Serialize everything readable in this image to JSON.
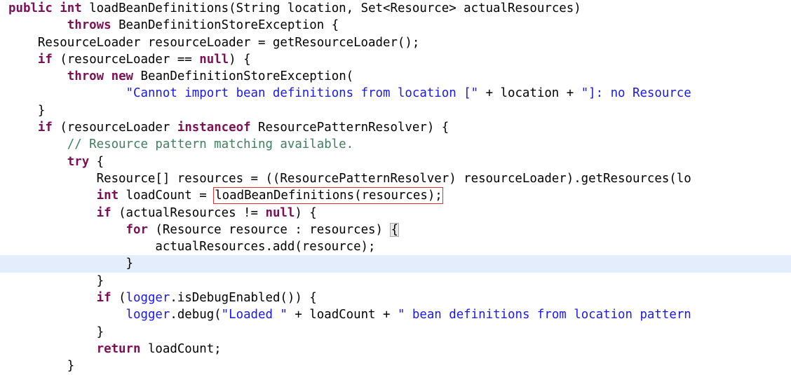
{
  "editor": {
    "language": "java",
    "theme": "eclipse-light",
    "background_color": "#ffffff",
    "highlight_line_color": "#e4edfb",
    "search_match_box_color": "#e03030",
    "bracket_match_box_color": "#a8a8a8",
    "colors": {
      "keyword": "#7f0f55",
      "string": "#1a1ae6",
      "comment": "#3f7f5f",
      "field": "#1a1ae6",
      "plain": "#000000"
    },
    "lines": [
      {
        "n": 1,
        "highlight": false,
        "tokens": [
          {
            "t": "public",
            "c": "kw"
          },
          {
            "t": " ",
            "c": "plain"
          },
          {
            "t": "int",
            "c": "kw"
          },
          {
            "t": " loadBeanDefinitions(String location, Set<Resource> actualResources)",
            "c": "plain"
          }
        ]
      },
      {
        "n": 2,
        "highlight": false,
        "tokens": [
          {
            "t": "        ",
            "c": "plain"
          },
          {
            "t": "throws",
            "c": "kw"
          },
          {
            "t": " BeanDefinitionStoreException {",
            "c": "plain"
          }
        ]
      },
      {
        "n": 3,
        "highlight": false,
        "tokens": [
          {
            "t": "    ResourceLoader resourceLoader = getResourceLoader();",
            "c": "plain"
          }
        ]
      },
      {
        "n": 4,
        "highlight": false,
        "tokens": [
          {
            "t": "    ",
            "c": "plain"
          },
          {
            "t": "if",
            "c": "kw"
          },
          {
            "t": " (resourceLoader == ",
            "c": "plain"
          },
          {
            "t": "null",
            "c": "kw"
          },
          {
            "t": ") {",
            "c": "plain"
          }
        ]
      },
      {
        "n": 5,
        "highlight": false,
        "tokens": [
          {
            "t": "        ",
            "c": "plain"
          },
          {
            "t": "throw",
            "c": "kw"
          },
          {
            "t": " ",
            "c": "plain"
          },
          {
            "t": "new",
            "c": "kw"
          },
          {
            "t": " BeanDefinitionStoreException(",
            "c": "plain"
          }
        ]
      },
      {
        "n": 6,
        "highlight": false,
        "tokens": [
          {
            "t": "                ",
            "c": "plain"
          },
          {
            "t": "\"Cannot import bean definitions from location [\"",
            "c": "str"
          },
          {
            "t": " + location + ",
            "c": "plain"
          },
          {
            "t": "\"]: no Resource",
            "c": "str"
          }
        ]
      },
      {
        "n": 7,
        "highlight": false,
        "tokens": [
          {
            "t": "    }",
            "c": "plain"
          }
        ]
      },
      {
        "n": 8,
        "highlight": false,
        "tokens": [
          {
            "t": "    ",
            "c": "plain"
          },
          {
            "t": "if",
            "c": "kw"
          },
          {
            "t": " (resourceLoader ",
            "c": "plain"
          },
          {
            "t": "instanceof",
            "c": "kw"
          },
          {
            "t": " ResourcePatternResolver) {",
            "c": "plain"
          }
        ]
      },
      {
        "n": 9,
        "highlight": false,
        "tokens": [
          {
            "t": "        ",
            "c": "plain"
          },
          {
            "t": "// Resource pattern matching available.",
            "c": "cmt"
          }
        ]
      },
      {
        "n": 10,
        "highlight": false,
        "tokens": [
          {
            "t": "        ",
            "c": "plain"
          },
          {
            "t": "try",
            "c": "kw"
          },
          {
            "t": " {",
            "c": "plain"
          }
        ]
      },
      {
        "n": 11,
        "highlight": false,
        "tokens": [
          {
            "t": "            Resource[] resources = ((ResourcePatternResolver) resourceLoader).getResources(lo",
            "c": "plain"
          }
        ]
      },
      {
        "n": 12,
        "highlight": false,
        "boxed": {
          "prefix": "            ",
          "kw": "int",
          "mid": " loadCount = ",
          "box": "loadBeanDefinitions(resources);"
        },
        "tokens": []
      },
      {
        "n": 13,
        "highlight": false,
        "tokens": [
          {
            "t": "            ",
            "c": "plain"
          },
          {
            "t": "if",
            "c": "kw"
          },
          {
            "t": " (actualResources != ",
            "c": "plain"
          },
          {
            "t": "null",
            "c": "kw"
          },
          {
            "t": ") {",
            "c": "plain"
          }
        ]
      },
      {
        "n": 14,
        "highlight": false,
        "bracket": {
          "prefix_plain": "                ",
          "kw": "for",
          "mid": " (Resource resource : resources) ",
          "brace": "{"
        },
        "tokens": []
      },
      {
        "n": 15,
        "highlight": false,
        "tokens": [
          {
            "t": "                    actualResources.add(resource);",
            "c": "plain"
          }
        ]
      },
      {
        "n": 16,
        "highlight": true,
        "tokens": [
          {
            "t": "                }",
            "c": "plain"
          }
        ]
      },
      {
        "n": 17,
        "highlight": false,
        "tokens": [
          {
            "t": "            }",
            "c": "plain"
          }
        ]
      },
      {
        "n": 18,
        "highlight": false,
        "tokens": [
          {
            "t": "            ",
            "c": "plain"
          },
          {
            "t": "if",
            "c": "kw"
          },
          {
            "t": " (",
            "c": "plain"
          },
          {
            "t": "logger",
            "c": "field"
          },
          {
            "t": ".isDebugEnabled()) {",
            "c": "plain"
          }
        ]
      },
      {
        "n": 19,
        "highlight": false,
        "tokens": [
          {
            "t": "                ",
            "c": "plain"
          },
          {
            "t": "logger",
            "c": "field"
          },
          {
            "t": ".debug(",
            "c": "plain"
          },
          {
            "t": "\"Loaded \"",
            "c": "str"
          },
          {
            "t": " + loadCount + ",
            "c": "plain"
          },
          {
            "t": "\" bean definitions from location pattern",
            "c": "str"
          }
        ]
      },
      {
        "n": 20,
        "highlight": false,
        "tokens": [
          {
            "t": "            }",
            "c": "plain"
          }
        ]
      },
      {
        "n": 21,
        "highlight": false,
        "tokens": [
          {
            "t": "            ",
            "c": "plain"
          },
          {
            "t": "return",
            "c": "kw"
          },
          {
            "t": " loadCount;",
            "c": "plain"
          }
        ]
      },
      {
        "n": 22,
        "highlight": false,
        "tokens": [
          {
            "t": "        }",
            "c": "plain"
          }
        ]
      }
    ]
  }
}
